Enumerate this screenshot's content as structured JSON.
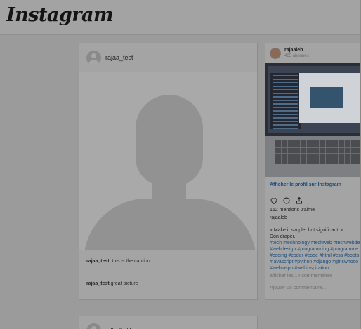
{
  "app": {
    "logo": "Instagram"
  },
  "feed": {
    "post1": {
      "username": "rajaa_test",
      "caption_user": "rajaa_test",
      "caption_text": "this is the caption",
      "comment_user": "rajaa_test",
      "comment_text": "great picture"
    },
    "post2": {
      "username": "zdlkdlzdlkze"
    }
  },
  "embed": {
    "username": "rajaaleb",
    "followers": "465 abonnés",
    "profile_link": "Afficher le profil sur Instagram",
    "likes": "162 mentions J'aime",
    "author": "rajaaleb",
    "description_lines": [
      "« Make it simple, but significant. »",
      "Don draper."
    ],
    "hashtag_lines": [
      "#tech #technology #techweb #techwebde",
      "#webdesign #programming #programme",
      "#coding #coder #code #html #css #boots",
      "#javascript #python #django #girlswhoco",
      "#webinspo #webinspiration"
    ],
    "view_comments": "afficher les 14 commentaires",
    "add_comment_placeholder": "Ajouter un commentaire..."
  },
  "icons": {
    "like": "heart-icon",
    "comment": "comment-icon",
    "share": "share-icon",
    "avatar": "default-avatar-icon"
  },
  "colors": {
    "overlay_background": "#9b9b9b",
    "link_blue": "#1f4f7d"
  }
}
